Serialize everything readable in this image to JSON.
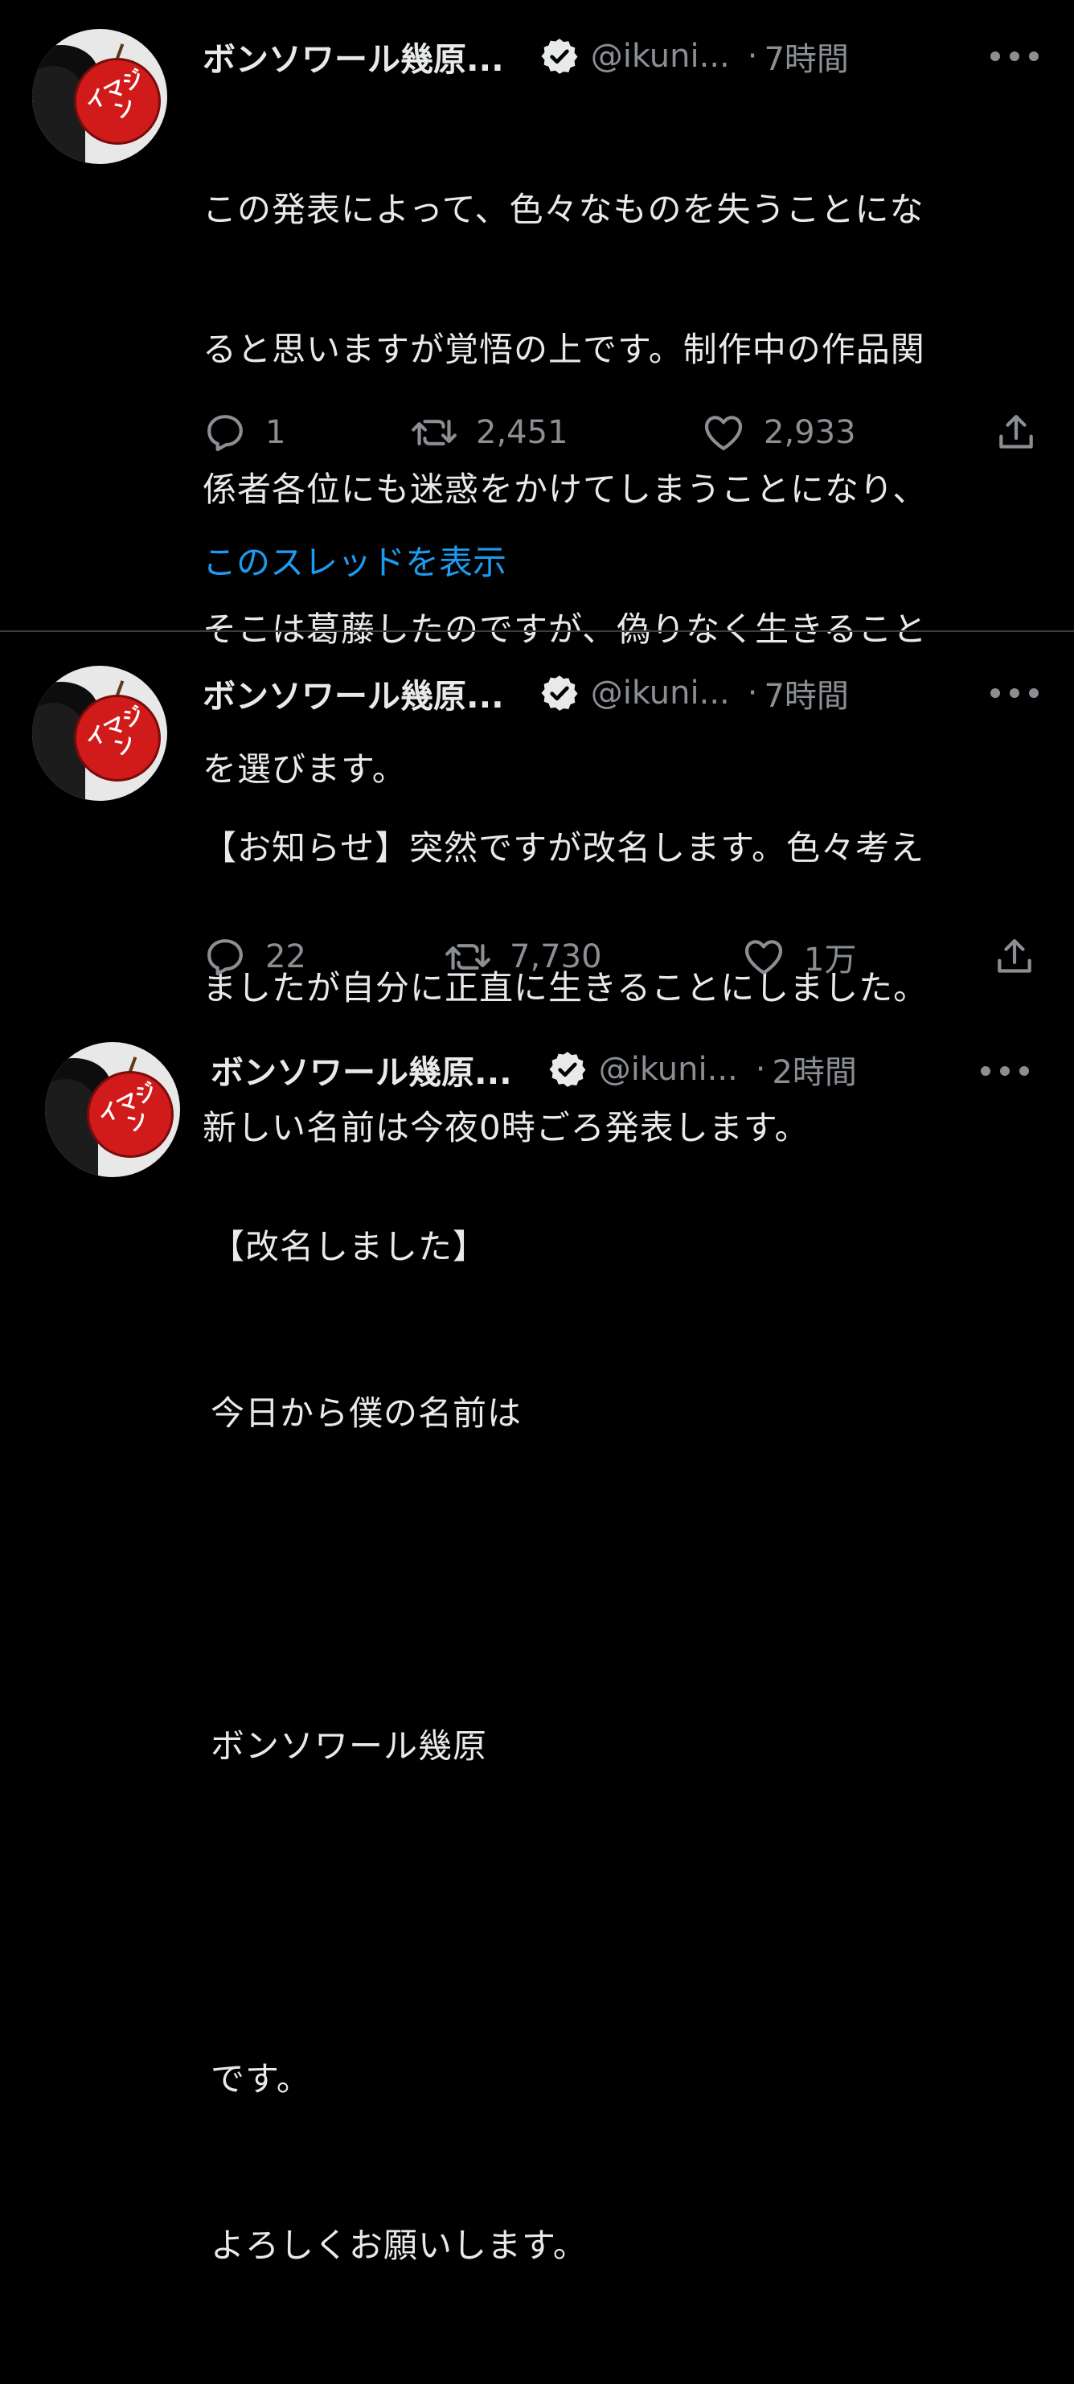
{
  "colors": {
    "background": "#000000",
    "text": "#e7e9ea",
    "muted": "#8b8f94",
    "link": "#1d9bf0",
    "divider": "#3a3d41"
  },
  "tweets": [
    {
      "name": "ボンソワール幾原...",
      "handle": "@ikuni...",
      "separator": "·",
      "time": "7時間",
      "avatar_text": "イマジン",
      "icons": [
        "verified-badge-icon",
        "more-options-icon",
        "reply-icon",
        "retweet-icon",
        "like-icon",
        "share-icon"
      ],
      "lines": [
        "この発表によって、色々なものを失うことにな",
        "ると思いますが覚悟の上です。制作中の作品関",
        "係者各位にも迷惑をかけてしまうことになり、",
        "そこは葛藤したのですが、偽りなく生きること",
        "を選びます。"
      ],
      "replies": "1",
      "retweets": "2,451",
      "likes": "2,933",
      "thread_link": "このスレッドを表示"
    },
    {
      "name": "ボンソワール幾原...",
      "handle": "@ikuni...",
      "separator": "·",
      "time": "7時間",
      "avatar_text": "イマジン",
      "lines": [
        "【お知らせ】突然ですが改名します。色々考え",
        "ましたが自分に正直に生きることにしました。",
        "新しい名前は今夜0時ごろ発表します。"
      ],
      "replies": "22",
      "retweets": "7,730",
      "likes": "1万"
    },
    {
      "name": "ボンソワール幾原...",
      "handle": "@ikuni...",
      "separator": "·",
      "time": "2時間",
      "avatar_text": "イマジン",
      "lines": [
        "【改名しました】",
        "今日から僕の名前は",
        "",
        "ボンソワール幾原",
        "",
        "です。",
        "よろしくお願いします。"
      ]
    }
  ]
}
